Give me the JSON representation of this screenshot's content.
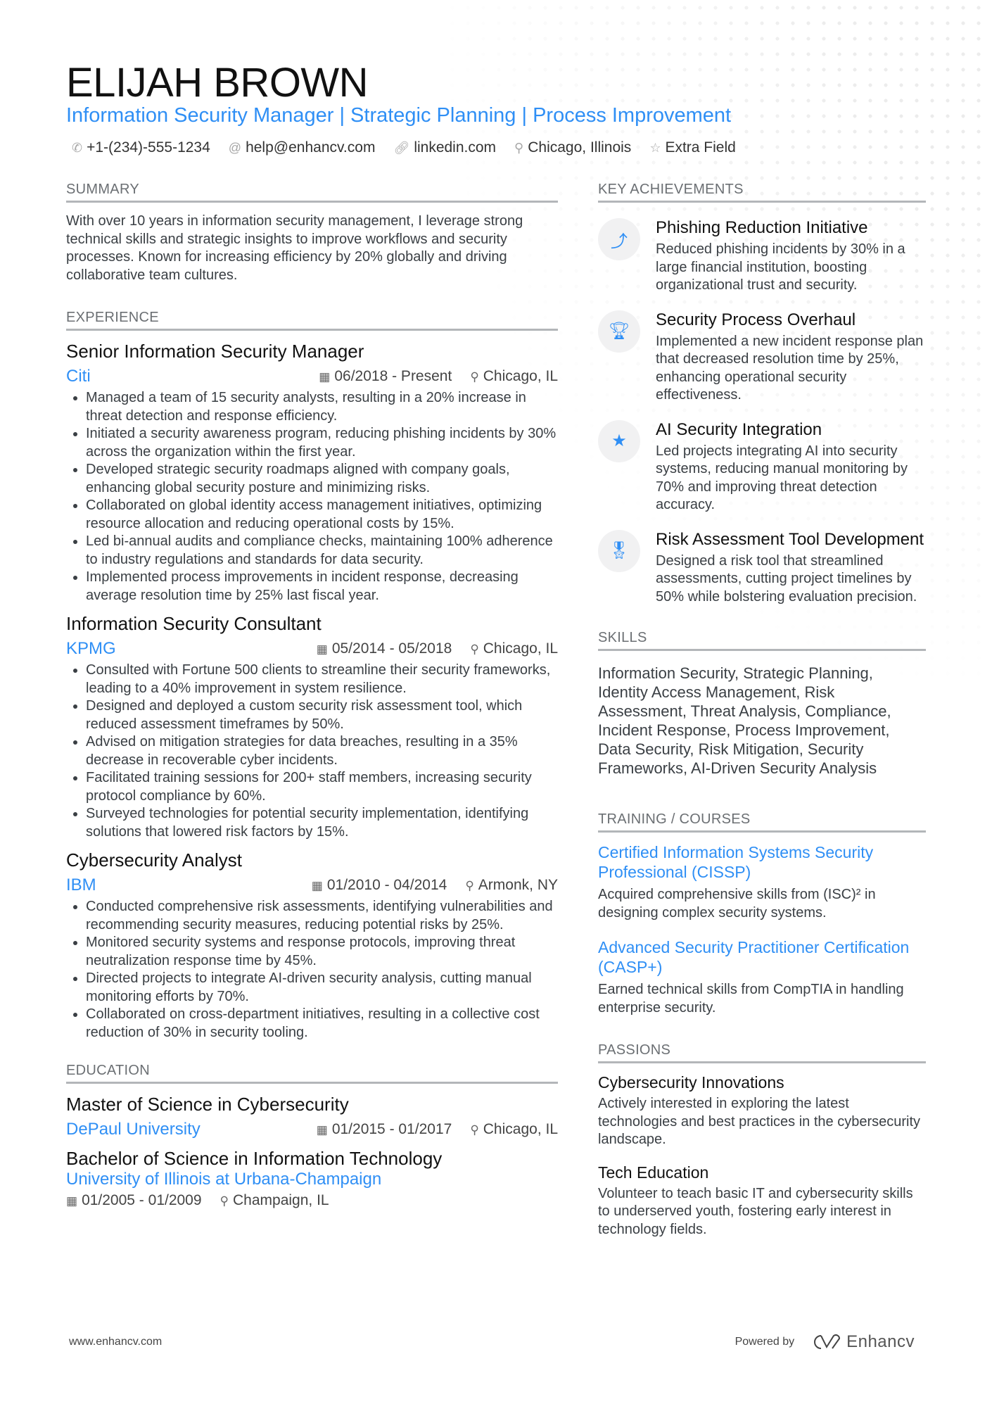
{
  "header": {
    "name": "ELIJAH BROWN",
    "headline": "Information Security Manager | Strategic Planning | Process Improvement",
    "contacts": [
      {
        "icon": "phone-icon",
        "glyph": "✆",
        "text": "+1-(234)-555-1234"
      },
      {
        "icon": "at-icon",
        "glyph": "@",
        "text": "help@enhancv.com"
      },
      {
        "icon": "link-icon",
        "glyph": "🔗︎",
        "text": "linkedin.com"
      },
      {
        "icon": "map-pin-icon",
        "glyph": "⚲",
        "text": "Chicago, Illinois"
      },
      {
        "icon": "star-icon",
        "glyph": "☆",
        "text": "Extra Field"
      }
    ]
  },
  "summary": {
    "title": "SUMMARY",
    "text": "With over 10 years in information security management, I leverage strong technical skills and strategic insights to improve workflows and security processes. Known for increasing efficiency by 20% globally and driving collaborative team cultures."
  },
  "experience": {
    "title": "EXPERIENCE",
    "jobs": [
      {
        "title": "Senior Information Security Manager",
        "company": "Citi",
        "dates": "06/2018 - Present",
        "location": "Chicago, IL",
        "bullets": [
          "Managed a team of 15 security analysts, resulting in a 20% increase in threat detection and response efficiency.",
          "Initiated a security awareness program, reducing phishing incidents by 30% across the organization within the first year.",
          "Developed strategic security roadmaps aligned with company goals, enhancing global security posture and minimizing risks.",
          "Collaborated on global identity access management initiatives, optimizing resource allocation and reducing operational costs by 15%.",
          "Led bi-annual audits and compliance checks, maintaining 100% adherence to industry regulations and standards for data security.",
          "Implemented process improvements in incident response, decreasing average resolution time by 25% last fiscal year."
        ]
      },
      {
        "title": "Information Security Consultant",
        "company": "KPMG",
        "dates": "05/2014 - 05/2018",
        "location": "Chicago, IL",
        "bullets": [
          "Consulted with Fortune 500 clients to streamline their security frameworks, leading to a 40% improvement in system resilience.",
          "Designed and deployed a custom security risk assessment tool, which reduced assessment timeframes by 50%.",
          "Advised on mitigation strategies for data breaches, resulting in a 35% decrease in recoverable cyber incidents.",
          "Facilitated training sessions for 200+ staff members, increasing security protocol compliance by 60%.",
          "Surveyed technologies for potential security implementation, identifying solutions that lowered risk factors by 15%."
        ]
      },
      {
        "title": "Cybersecurity Analyst",
        "company": "IBM",
        "dates": "01/2010 - 04/2014",
        "location": "Armonk, NY",
        "bullets": [
          "Conducted comprehensive risk assessments, identifying vulnerabilities and recommending security measures, reducing potential risks by 25%.",
          "Monitored security systems and response protocols, improving threat neutralization response time by 45%.",
          "Directed projects to integrate AI-driven security analysis, cutting manual monitoring efforts by 70%.",
          "Collaborated on cross-department initiatives, resulting in a collective cost reduction of 30% in security tooling."
        ]
      }
    ]
  },
  "education": {
    "title": "EDUCATION",
    "items": [
      {
        "degree": "Master of Science in Cybersecurity",
        "school": "DePaul University",
        "dates": "01/2015 - 01/2017",
        "location": "Chicago, IL"
      },
      {
        "degree": "Bachelor of Science in Information Technology",
        "school": "University of Illinois at Urbana-Champaign",
        "dates": "01/2005 - 01/2009",
        "location": "Champaign, IL"
      }
    ]
  },
  "achievements": {
    "title": "KEY ACHIEVEMENTS",
    "items": [
      {
        "icon": "strategy-icon",
        "glyph": "⤴",
        "title": "Phishing Reduction Initiative",
        "desc": "Reduced phishing incidents by 30% in a large financial institution, boosting organizational trust and security."
      },
      {
        "icon": "trophy-icon",
        "glyph": "🏆︎",
        "title": "Security Process Overhaul",
        "desc": "Implemented a new incident response plan that decreased resolution time by 25%, enhancing operational security effectiveness."
      },
      {
        "icon": "star-icon",
        "glyph": "★",
        "title": "AI Security Integration",
        "desc": "Led projects integrating AI into security systems, reducing manual monitoring by 70% and improving threat detection accuracy."
      },
      {
        "icon": "award-ribbon-icon",
        "glyph": "🎖︎",
        "title": "Risk Assessment Tool Development",
        "desc": "Designed a risk tool that streamlined assessments, cutting project timelines by 50% while bolstering evaluation precision."
      }
    ]
  },
  "skills": {
    "title": "SKILLS",
    "text": "Information Security, Strategic Planning, Identity Access Management, Risk Assessment, Threat Analysis, Compliance, Incident Response, Process Improvement, Data Security, Risk Mitigation, Security Frameworks, AI-Driven Security Analysis"
  },
  "training": {
    "title": "TRAINING / COURSES",
    "items": [
      {
        "title": "Certified Information Systems Security Professional (CISSP)",
        "desc": "Acquired comprehensive skills from (ISC)² in designing complex security systems."
      },
      {
        "title": "Advanced Security Practitioner Certification (CASP+)",
        "desc": "Earned technical skills from CompTIA in handling enterprise security."
      }
    ]
  },
  "passions": {
    "title": "PASSIONS",
    "items": [
      {
        "title": "Cybersecurity Innovations",
        "desc": "Actively interested in exploring the latest technologies and best practices in the cybersecurity landscape."
      },
      {
        "title": "Tech Education",
        "desc": "Volunteer to teach basic IT and cybersecurity skills to underserved youth, fostering early interest in technology fields."
      }
    ]
  },
  "footer": {
    "website": "www.enhancv.com",
    "powered_by": "Powered by",
    "brand": "Enhancv"
  },
  "icons": {
    "calendar": "▦",
    "pin": "⚲"
  }
}
